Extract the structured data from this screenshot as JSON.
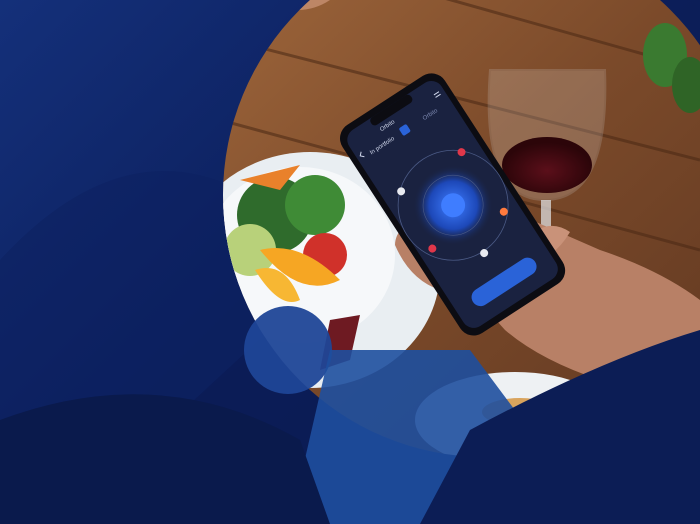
{
  "colors": {
    "background_dark": "#0a1a4c",
    "background_mid": "#14307a",
    "accent_blue": "#2a63d8",
    "accent_light": "#2d4fa8",
    "wood": "#8b5a36",
    "phone_screen": "#1a2240"
  },
  "phone_screen": {
    "app_name": "Orbito",
    "tab_label": "Orbito",
    "back_label": "In portfolio",
    "cta_label": ""
  },
  "icons": [
    "menu-icon",
    "back-arrow-icon",
    "profile-icon"
  ]
}
